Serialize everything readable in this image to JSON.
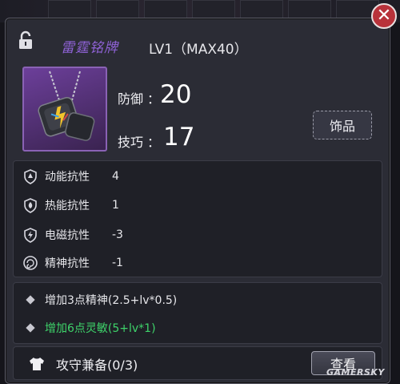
{
  "header": {
    "item_name": "雷霆铭牌",
    "level_text": "LV1（MAX40）"
  },
  "stats": {
    "defense_label": "防御",
    "defense_value": "20",
    "skill_label": "技巧",
    "skill_value": "17",
    "colon": "："
  },
  "item_type": "饰品",
  "resistances": [
    {
      "name": "动能抗性",
      "value": "4",
      "icon": "kinetic-resist-icon"
    },
    {
      "name": "热能抗性",
      "value": "1",
      "icon": "thermal-resist-icon"
    },
    {
      "name": "电磁抗性",
      "value": "-3",
      "icon": "em-resist-icon"
    },
    {
      "name": "精神抗性",
      "value": "-1",
      "icon": "mental-resist-icon"
    }
  ],
  "bonuses": [
    {
      "text": "增加3点精神(2.5+lv*0.5)",
      "color": "#e6e6ea"
    },
    {
      "text": "增加6点灵敏(5+lv*1)",
      "color": "#3ed36a"
    }
  ],
  "set": {
    "label": "攻守兼备(0/3)",
    "view_button": "查看"
  },
  "watermark": "GAMERSKY",
  "colors": {
    "name_purple": "#8f62d6",
    "close_red": "#b8323a",
    "bonus_green": "#3ed36a"
  }
}
